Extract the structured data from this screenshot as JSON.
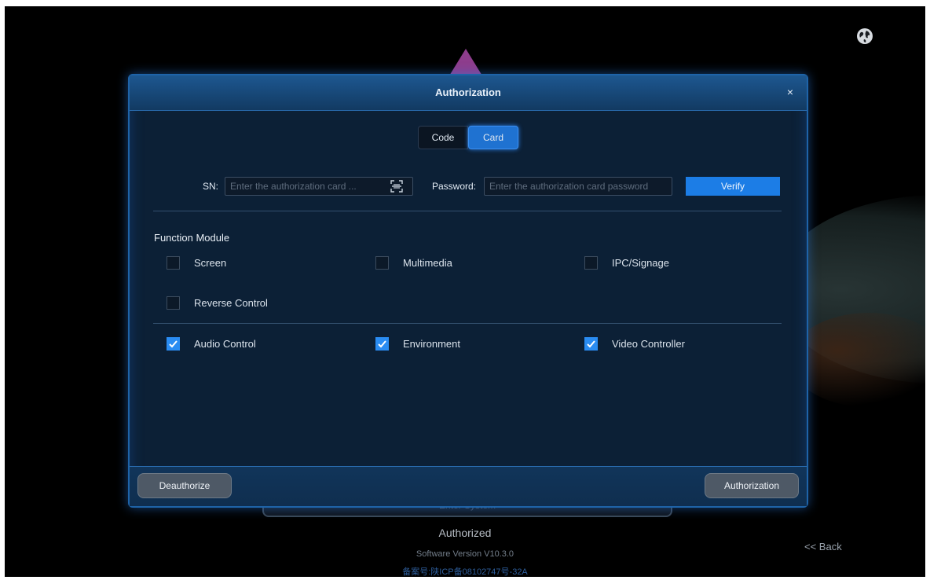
{
  "dialog": {
    "title": "Authorization",
    "close": "×",
    "tabs": [
      {
        "label": "Code",
        "active": false
      },
      {
        "label": "Card",
        "active": true
      }
    ],
    "sn_label": "SN:",
    "sn_placeholder": "Enter the authorization card ...",
    "password_label": "Password:",
    "password_placeholder": "Enter the authorization card password",
    "verify_label": "Verify",
    "function_module_title": "Function Module",
    "modules": [
      {
        "label": "Screen",
        "checked": false
      },
      {
        "label": "Multimedia",
        "checked": false
      },
      {
        "label": "IPC/Signage",
        "checked": false
      },
      {
        "label": "Reverse Control",
        "checked": false
      },
      {
        "label": "Audio Control",
        "checked": true
      },
      {
        "label": "Environment",
        "checked": true
      },
      {
        "label": "Video Controller",
        "checked": true
      }
    ],
    "deauthorize_label": "Deauthorize",
    "authorization_label": "Authorization"
  },
  "background": {
    "panel_text": "Enter System",
    "status": "Authorized",
    "version": "Software Version V10.3.0",
    "icp": "备案号:陕ICP备08102747号-32A",
    "back": "<< Back"
  },
  "colors": {
    "accent": "#1c7de6",
    "dialog_bg": "#0c2036",
    "border": "#1e63a8"
  },
  "icons": [
    "globe-icon",
    "close-icon",
    "scan-icon",
    "check-icon"
  ]
}
